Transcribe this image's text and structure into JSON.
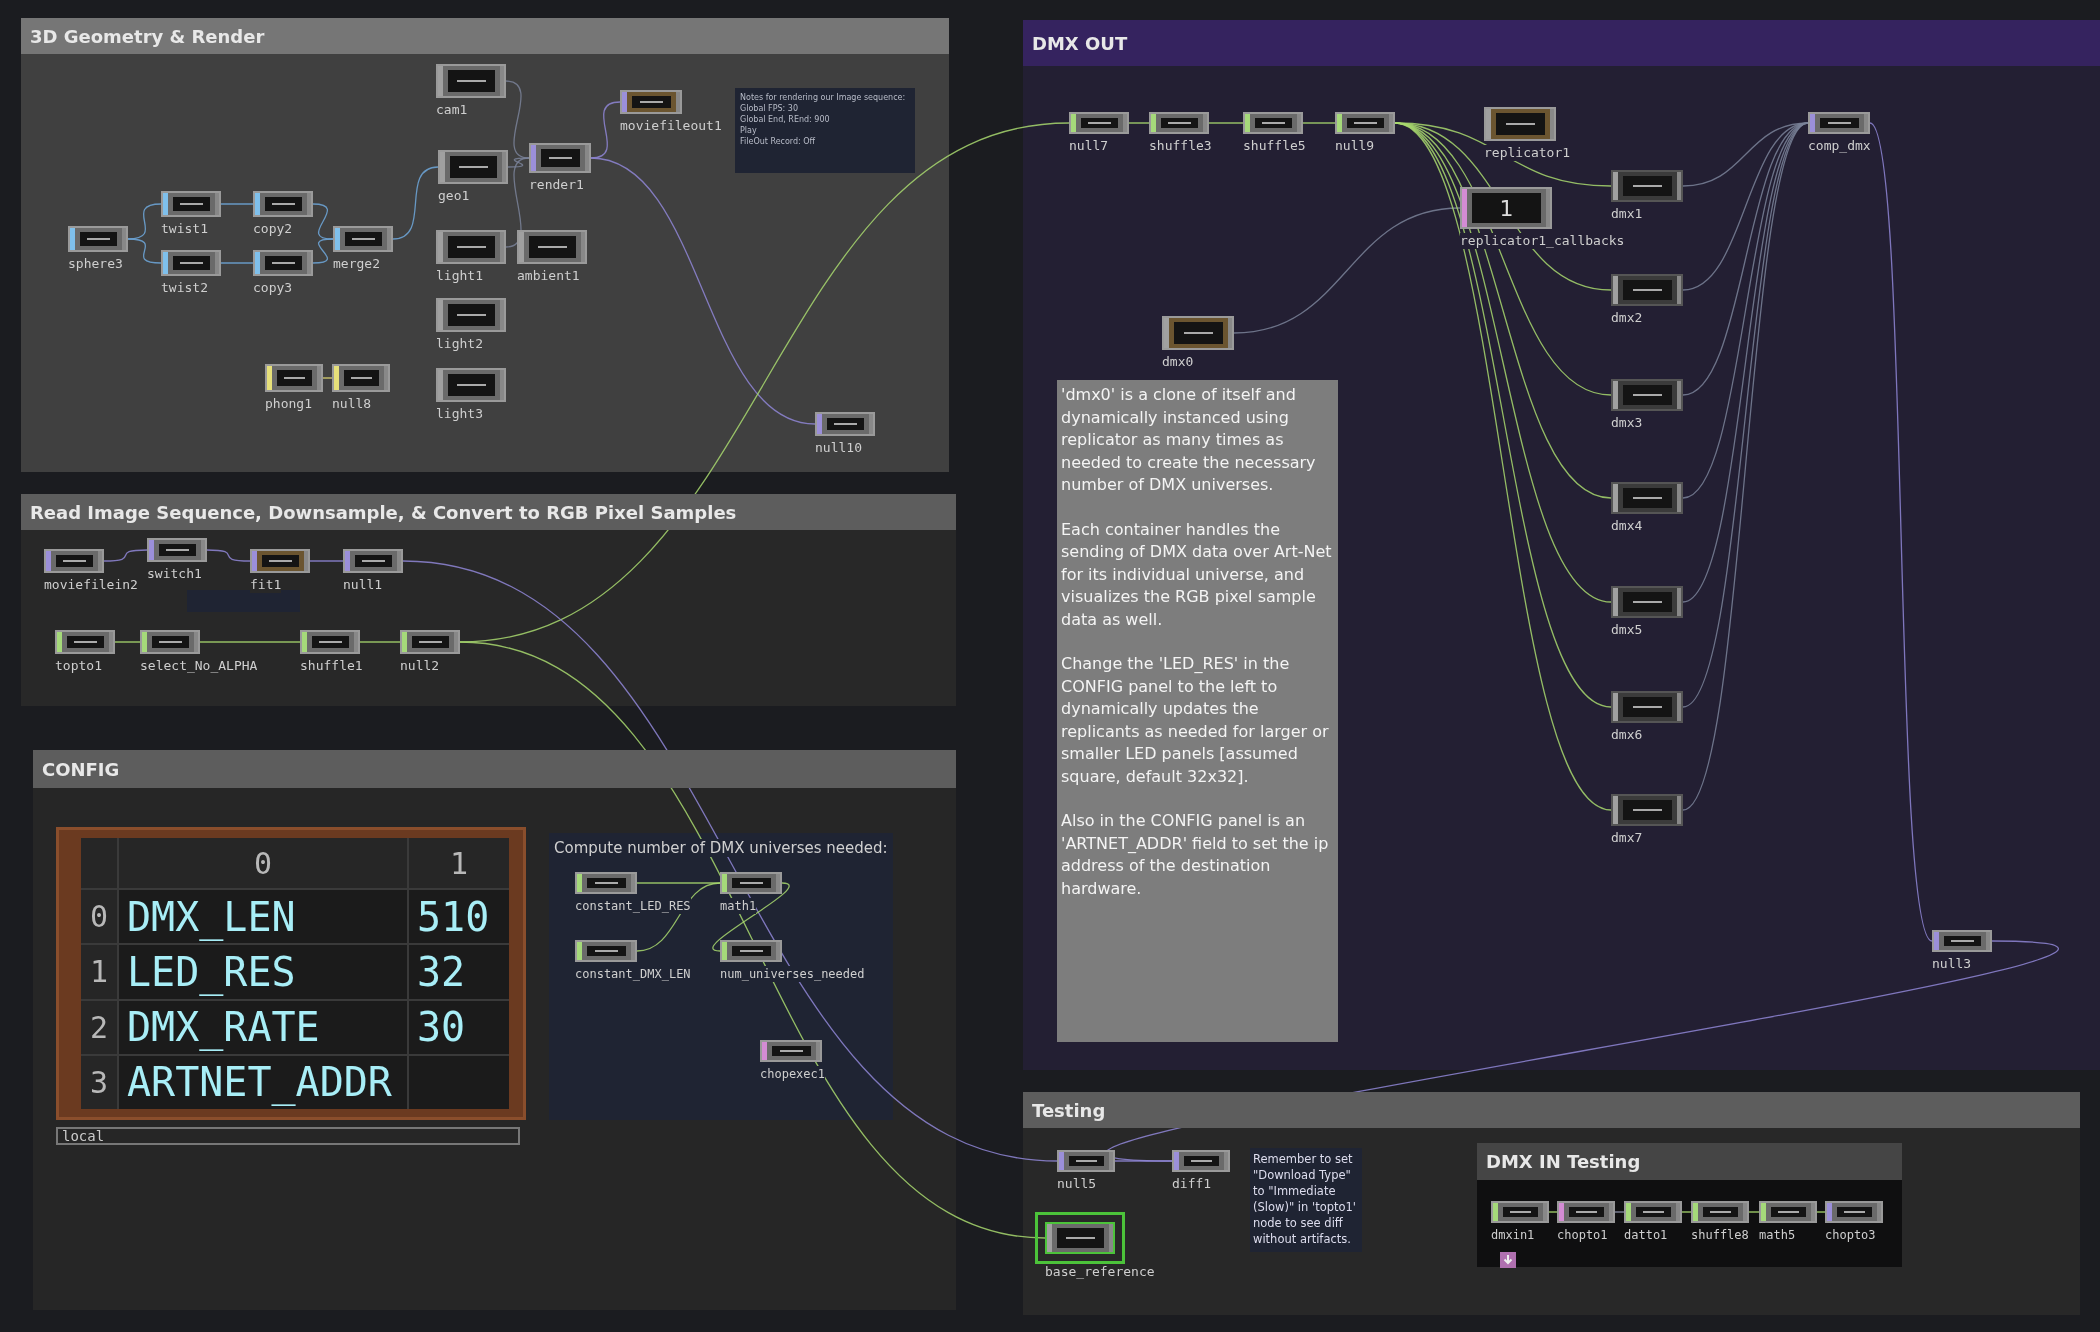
{
  "panels": [
    {
      "title": "3D Geometry & Render",
      "nodes": [
        {
          "label": "cam1",
          "kind": "comp"
        },
        {
          "label": "geo1",
          "kind": "comp"
        },
        {
          "label": "render1",
          "kind": "top"
        },
        {
          "label": "moviefileout1",
          "kind": "top",
          "color": "#6b5530"
        },
        {
          "label": "sphere3",
          "kind": "sop"
        },
        {
          "label": "twist1",
          "kind": "sop"
        },
        {
          "label": "twist2",
          "kind": "sop"
        },
        {
          "label": "copy2",
          "kind": "sop"
        },
        {
          "label": "copy3",
          "kind": "sop"
        },
        {
          "label": "merge2",
          "kind": "sop"
        },
        {
          "label": "light1",
          "kind": "comp"
        },
        {
          "label": "ambient1",
          "kind": "comp"
        },
        {
          "label": "light2",
          "kind": "comp"
        },
        {
          "label": "light3",
          "kind": "comp"
        },
        {
          "label": "phong1",
          "kind": "mat"
        },
        {
          "label": "null8",
          "kind": "mat"
        },
        {
          "label": "null10",
          "kind": "top"
        }
      ],
      "note": {
        "lines": [
          "Notes for rendering our Image sequence:",
          "Global FPS: 30",
          "Global End, REnd: 900",
          "Play",
          "FileOut Record: Off"
        ]
      }
    },
    {
      "title": "Read Image Sequence, Downsample, & Convert to RGB Pixel Samples",
      "nodes": [
        {
          "label": "moviefilein2",
          "kind": "top"
        },
        {
          "label": "switch1",
          "kind": "top"
        },
        {
          "label": "fit1",
          "kind": "top",
          "color": "#6b5530"
        },
        {
          "label": "null1",
          "kind": "top"
        },
        {
          "label": "topto1",
          "kind": "chop"
        },
        {
          "label": "select_No_ALPHA",
          "kind": "chop"
        },
        {
          "label": "shuffle1",
          "kind": "chop"
        },
        {
          "label": "null2",
          "kind": "chop"
        }
      ]
    },
    {
      "title": "CONFIG",
      "table": {
        "columns": [
          "0",
          "1"
        ],
        "rows": [
          {
            "index": "0",
            "cells": [
              "DMX_LEN",
              "510"
            ]
          },
          {
            "index": "1",
            "cells": [
              "LED_RES",
              "32"
            ]
          },
          {
            "index": "2",
            "cells": [
              "DMX_RATE",
              "30"
            ]
          },
          {
            "index": "3",
            "cells": [
              "ARTNET_ADDR"
            ]
          }
        ],
        "footer": "local"
      },
      "compute_title": "Compute number of DMX universes needed:",
      "nodes": [
        {
          "label": "constant_LED_RES",
          "kind": "chop"
        },
        {
          "label": "math1",
          "kind": "chop"
        },
        {
          "label": "constant_DMX_LEN",
          "kind": "chop"
        },
        {
          "label": "num_universes_needed",
          "kind": "chop"
        },
        {
          "label": "chopexec1",
          "kind": "dat"
        }
      ]
    },
    {
      "title": "DMX OUT",
      "nodes": [
        {
          "label": "null7",
          "kind": "chop"
        },
        {
          "label": "shuffle3",
          "kind": "chop"
        },
        {
          "label": "shuffle5",
          "kind": "chop"
        },
        {
          "label": "null9",
          "kind": "chop"
        },
        {
          "label": "replicator1",
          "kind": "comp",
          "color": "#6b5530"
        },
        {
          "label": "replicator1_callbacks",
          "kind": "dat",
          "display": "1"
        },
        {
          "label": "comp_dmx",
          "kind": "top"
        },
        {
          "label": "dmx0",
          "kind": "comp",
          "color": "#6b5530"
        },
        {
          "label": "dmx1",
          "kind": "comp",
          "color": "#3b3b3b"
        },
        {
          "label": "dmx2",
          "kind": "comp",
          "color": "#3b3b3b"
        },
        {
          "label": "dmx3",
          "kind": "comp",
          "color": "#3b3b3b"
        },
        {
          "label": "dmx4",
          "kind": "comp",
          "color": "#3b3b3b"
        },
        {
          "label": "dmx5",
          "kind": "comp",
          "color": "#3b3b3b"
        },
        {
          "label": "dmx6",
          "kind": "comp",
          "color": "#3b3b3b"
        },
        {
          "label": "dmx7",
          "kind": "comp",
          "color": "#3b3b3b"
        },
        {
          "label": "null3",
          "kind": "top"
        }
      ],
      "comment": [
        "'dmx0' is a clone of itself and dynamically instanced using replicator as many times as needed to create the necessary number of DMX universes.",
        "Each container handles the sending of DMX data over Art-Net for its individual universe, and visualizes the RGB pixel sample data as well.",
        "Change the 'LED_RES' in the CONFIG panel to the left to dynamically updates the replicants as needed for larger or smaller LED panels [assumed square, default 32x32].",
        "Also in the CONFIG panel is an 'ARTNET_ADDR' field to set the ip address of the destination hardware."
      ]
    },
    {
      "title": "Testing",
      "nodes": [
        {
          "label": "null5",
          "kind": "top",
          "selected": false
        },
        {
          "label": "diff1",
          "kind": "top",
          "selected": false
        },
        {
          "label": "base_reference",
          "kind": "comp",
          "selected": true
        }
      ],
      "note": "Remember to set \"Download Type\" to \"Immediate (Slow)\" in 'topto1' node to see diff without artifacts.",
      "subpanel": {
        "title": "DMX IN Testing",
        "nodes": [
          {
            "label": "dmxin1",
            "kind": "chop"
          },
          {
            "label": "chopto1",
            "kind": "dat"
          },
          {
            "label": "datto1",
            "kind": "chop"
          },
          {
            "label": "shuffle8",
            "kind": "chop"
          },
          {
            "label": "math5",
            "kind": "chop"
          },
          {
            "label": "chopto3",
            "kind": "top"
          }
        ]
      }
    }
  ]
}
